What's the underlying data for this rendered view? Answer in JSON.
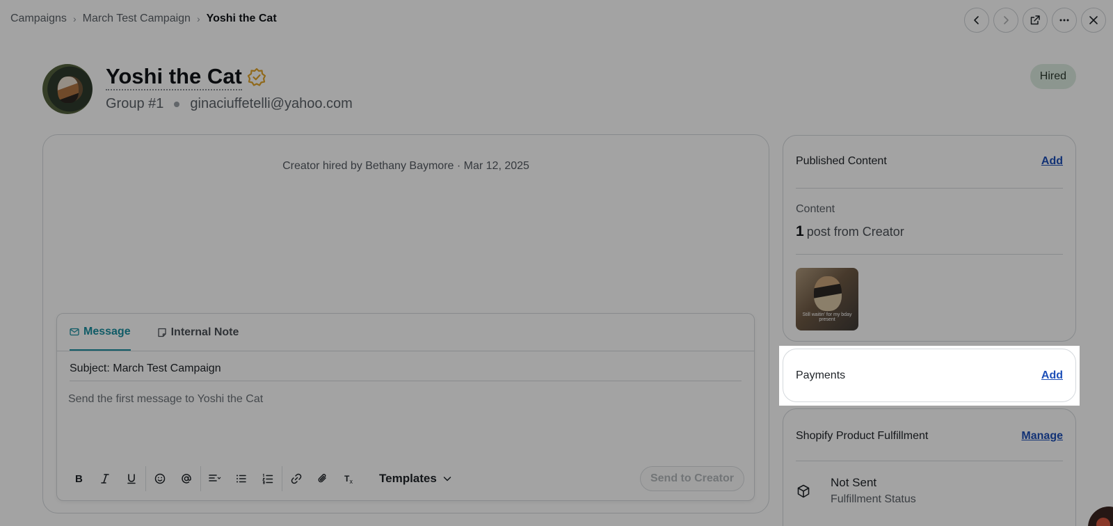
{
  "breadcrumb": {
    "items": [
      "Campaigns",
      "March Test Campaign"
    ],
    "current": "Yoshi the Cat",
    "separator": "›"
  },
  "nav": {
    "icons": [
      "chevron-left-icon",
      "chevron-right-icon",
      "external-link-icon",
      "more-icon",
      "close-icon"
    ]
  },
  "creator": {
    "name": "Yoshi the Cat",
    "group": "Group #1",
    "email": "ginaciuffetelli@yahoo.com",
    "status": "Hired"
  },
  "activity": {
    "event": "Creator hired by Bethany Baymore · Mar 12, 2025"
  },
  "composer": {
    "tabs": [
      {
        "label": "Message",
        "active": true
      },
      {
        "label": "Internal Note",
        "active": false
      }
    ],
    "subject": "Subject: March Test Campaign",
    "placeholder": "Send the first message to Yoshi the Cat",
    "templates_label": "Templates",
    "send_label": "Send to Creator"
  },
  "published": {
    "title": "Published Content",
    "add_label": "Add",
    "content_label": "Content",
    "count": "1",
    "count_suffix": "post from Creator",
    "thumbnail_caption": "Still waitin' for my bday present"
  },
  "payments": {
    "title": "Payments",
    "add_label": "Add"
  },
  "shopify": {
    "title": "Shopify Product Fulfillment",
    "manage_label": "Manage",
    "status": "Not Sent",
    "status_label": "Fulfillment Status"
  },
  "colors": {
    "accent": "#1a8fa0",
    "link": "#1d4fb8",
    "verified": "#e2a52b",
    "hired_badge": "#dcebe0"
  }
}
